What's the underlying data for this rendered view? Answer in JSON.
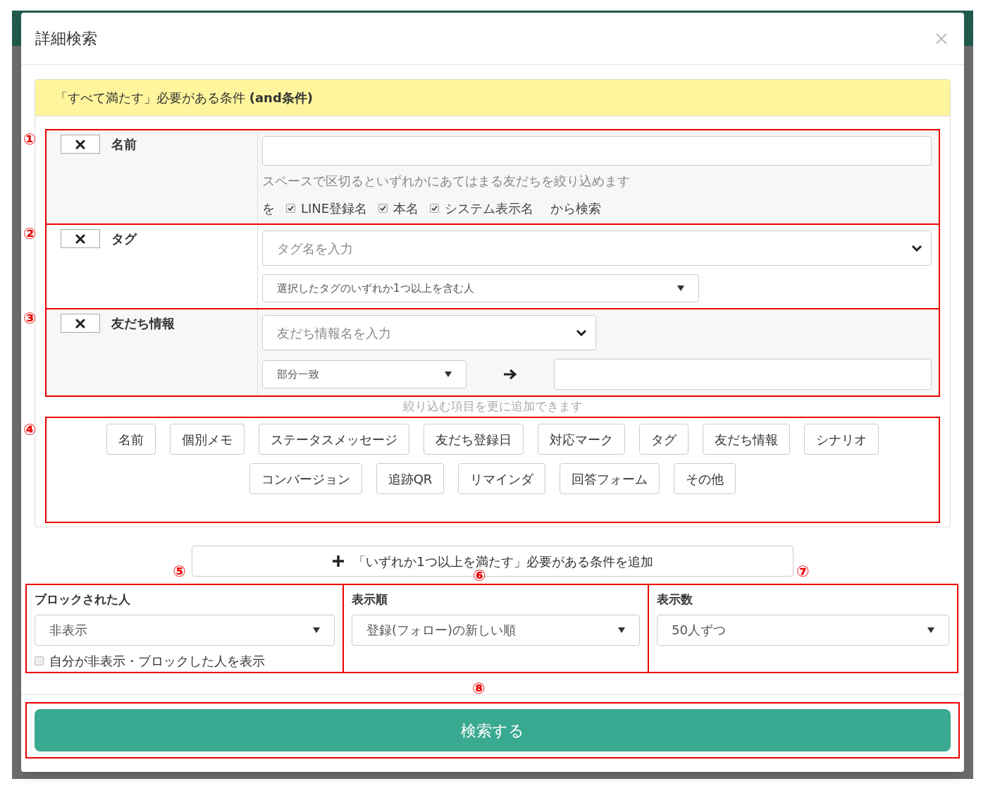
{
  "dialog": {
    "title": "詳細検索"
  },
  "and_panel": {
    "heading": "「すべて満たす」必要がある条件 **(and条件)**",
    "conditions": [
      {
        "kind": "name",
        "marker": "①",
        "label": "名前",
        "hint": "スペースで区切るといずれかにあてはまる友だちを絞り込めます",
        "prefix": "を",
        "options": [
          {
            "label": "LINE登録名",
            "checked": true
          },
          {
            "label": "本名",
            "checked": true
          },
          {
            "label": "システム表示名",
            "checked": true
          }
        ],
        "suffix": "から検索"
      },
      {
        "kind": "tag",
        "marker": "②",
        "label": "タグ",
        "placeholder": "タグ名を入力",
        "match": "選択したタグのいずれか1つ以上を含む人"
      },
      {
        "kind": "info",
        "marker": "③",
        "label": "友だち情報",
        "placeholder": "友だち情報名を入力",
        "match": "部分一致"
      }
    ],
    "add_hint": "絞り込む項目を更に追加できます",
    "add_marker": "④",
    "add_buttons": [
      [
        "名前",
        "個別メモ",
        "ステータスメッセージ",
        "友だち登録日",
        "対応マーク",
        "タグ",
        "友だち情報",
        "シナリオ"
      ],
      [
        "コンバージョン",
        "追跡QR",
        "リマインダ",
        "回答フォーム",
        "その他"
      ]
    ]
  },
  "or_button": "「いずれか1つ以上を満たす」必要がある条件を追加",
  "settings": [
    {
      "marker": "⑤",
      "label": "ブロックされた人",
      "value": "非表示",
      "checkbox": {
        "label": "自分が非表示・ブロックした人を表示",
        "checked": false
      }
    },
    {
      "marker": "⑥",
      "label": "表示順",
      "value": "登録(フォロー)の新しい順"
    },
    {
      "marker": "⑦",
      "label": "表示数",
      "value": "50人ずつ"
    }
  ],
  "submit": {
    "marker": "⑧",
    "label": "検索する"
  }
}
